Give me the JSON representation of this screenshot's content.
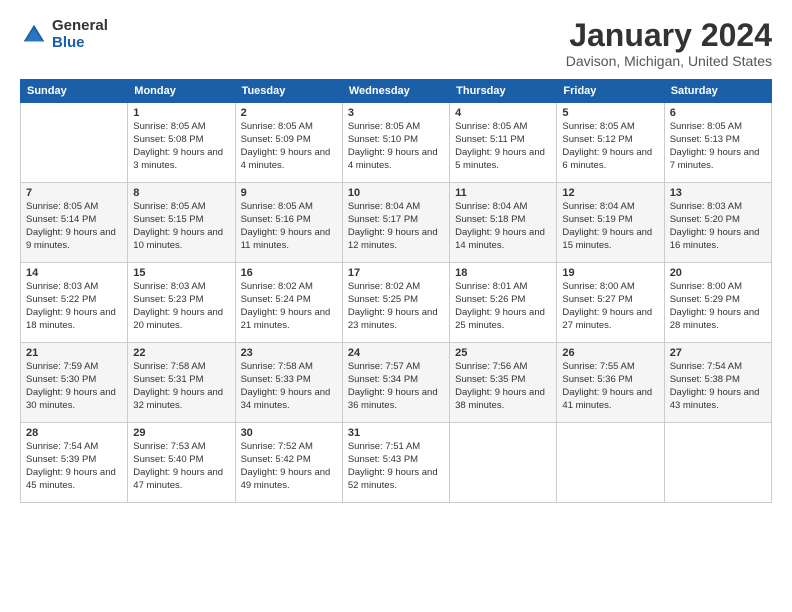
{
  "header": {
    "logo_general": "General",
    "logo_blue": "Blue",
    "title": "January 2024",
    "location": "Davison, Michigan, United States"
  },
  "calendar": {
    "days_of_week": [
      "Sunday",
      "Monday",
      "Tuesday",
      "Wednesday",
      "Thursday",
      "Friday",
      "Saturday"
    ],
    "weeks": [
      [
        {
          "day": "",
          "sunrise": "",
          "sunset": "",
          "daylight": ""
        },
        {
          "day": "1",
          "sunrise": "Sunrise: 8:05 AM",
          "sunset": "Sunset: 5:08 PM",
          "daylight": "Daylight: 9 hours and 3 minutes."
        },
        {
          "day": "2",
          "sunrise": "Sunrise: 8:05 AM",
          "sunset": "Sunset: 5:09 PM",
          "daylight": "Daylight: 9 hours and 4 minutes."
        },
        {
          "day": "3",
          "sunrise": "Sunrise: 8:05 AM",
          "sunset": "Sunset: 5:10 PM",
          "daylight": "Daylight: 9 hours and 4 minutes."
        },
        {
          "day": "4",
          "sunrise": "Sunrise: 8:05 AM",
          "sunset": "Sunset: 5:11 PM",
          "daylight": "Daylight: 9 hours and 5 minutes."
        },
        {
          "day": "5",
          "sunrise": "Sunrise: 8:05 AM",
          "sunset": "Sunset: 5:12 PM",
          "daylight": "Daylight: 9 hours and 6 minutes."
        },
        {
          "day": "6",
          "sunrise": "Sunrise: 8:05 AM",
          "sunset": "Sunset: 5:13 PM",
          "daylight": "Daylight: 9 hours and 7 minutes."
        }
      ],
      [
        {
          "day": "7",
          "sunrise": "Sunrise: 8:05 AM",
          "sunset": "Sunset: 5:14 PM",
          "daylight": "Daylight: 9 hours and 9 minutes."
        },
        {
          "day": "8",
          "sunrise": "Sunrise: 8:05 AM",
          "sunset": "Sunset: 5:15 PM",
          "daylight": "Daylight: 9 hours and 10 minutes."
        },
        {
          "day": "9",
          "sunrise": "Sunrise: 8:05 AM",
          "sunset": "Sunset: 5:16 PM",
          "daylight": "Daylight: 9 hours and 11 minutes."
        },
        {
          "day": "10",
          "sunrise": "Sunrise: 8:04 AM",
          "sunset": "Sunset: 5:17 PM",
          "daylight": "Daylight: 9 hours and 12 minutes."
        },
        {
          "day": "11",
          "sunrise": "Sunrise: 8:04 AM",
          "sunset": "Sunset: 5:18 PM",
          "daylight": "Daylight: 9 hours and 14 minutes."
        },
        {
          "day": "12",
          "sunrise": "Sunrise: 8:04 AM",
          "sunset": "Sunset: 5:19 PM",
          "daylight": "Daylight: 9 hours and 15 minutes."
        },
        {
          "day": "13",
          "sunrise": "Sunrise: 8:03 AM",
          "sunset": "Sunset: 5:20 PM",
          "daylight": "Daylight: 9 hours and 16 minutes."
        }
      ],
      [
        {
          "day": "14",
          "sunrise": "Sunrise: 8:03 AM",
          "sunset": "Sunset: 5:22 PM",
          "daylight": "Daylight: 9 hours and 18 minutes."
        },
        {
          "day": "15",
          "sunrise": "Sunrise: 8:03 AM",
          "sunset": "Sunset: 5:23 PM",
          "daylight": "Daylight: 9 hours and 20 minutes."
        },
        {
          "day": "16",
          "sunrise": "Sunrise: 8:02 AM",
          "sunset": "Sunset: 5:24 PM",
          "daylight": "Daylight: 9 hours and 21 minutes."
        },
        {
          "day": "17",
          "sunrise": "Sunrise: 8:02 AM",
          "sunset": "Sunset: 5:25 PM",
          "daylight": "Daylight: 9 hours and 23 minutes."
        },
        {
          "day": "18",
          "sunrise": "Sunrise: 8:01 AM",
          "sunset": "Sunset: 5:26 PM",
          "daylight": "Daylight: 9 hours and 25 minutes."
        },
        {
          "day": "19",
          "sunrise": "Sunrise: 8:00 AM",
          "sunset": "Sunset: 5:27 PM",
          "daylight": "Daylight: 9 hours and 27 minutes."
        },
        {
          "day": "20",
          "sunrise": "Sunrise: 8:00 AM",
          "sunset": "Sunset: 5:29 PM",
          "daylight": "Daylight: 9 hours and 28 minutes."
        }
      ],
      [
        {
          "day": "21",
          "sunrise": "Sunrise: 7:59 AM",
          "sunset": "Sunset: 5:30 PM",
          "daylight": "Daylight: 9 hours and 30 minutes."
        },
        {
          "day": "22",
          "sunrise": "Sunrise: 7:58 AM",
          "sunset": "Sunset: 5:31 PM",
          "daylight": "Daylight: 9 hours and 32 minutes."
        },
        {
          "day": "23",
          "sunrise": "Sunrise: 7:58 AM",
          "sunset": "Sunset: 5:33 PM",
          "daylight": "Daylight: 9 hours and 34 minutes."
        },
        {
          "day": "24",
          "sunrise": "Sunrise: 7:57 AM",
          "sunset": "Sunset: 5:34 PM",
          "daylight": "Daylight: 9 hours and 36 minutes."
        },
        {
          "day": "25",
          "sunrise": "Sunrise: 7:56 AM",
          "sunset": "Sunset: 5:35 PM",
          "daylight": "Daylight: 9 hours and 38 minutes."
        },
        {
          "day": "26",
          "sunrise": "Sunrise: 7:55 AM",
          "sunset": "Sunset: 5:36 PM",
          "daylight": "Daylight: 9 hours and 41 minutes."
        },
        {
          "day": "27",
          "sunrise": "Sunrise: 7:54 AM",
          "sunset": "Sunset: 5:38 PM",
          "daylight": "Daylight: 9 hours and 43 minutes."
        }
      ],
      [
        {
          "day": "28",
          "sunrise": "Sunrise: 7:54 AM",
          "sunset": "Sunset: 5:39 PM",
          "daylight": "Daylight: 9 hours and 45 minutes."
        },
        {
          "day": "29",
          "sunrise": "Sunrise: 7:53 AM",
          "sunset": "Sunset: 5:40 PM",
          "daylight": "Daylight: 9 hours and 47 minutes."
        },
        {
          "day": "30",
          "sunrise": "Sunrise: 7:52 AM",
          "sunset": "Sunset: 5:42 PM",
          "daylight": "Daylight: 9 hours and 49 minutes."
        },
        {
          "day": "31",
          "sunrise": "Sunrise: 7:51 AM",
          "sunset": "Sunset: 5:43 PM",
          "daylight": "Daylight: 9 hours and 52 minutes."
        },
        {
          "day": "",
          "sunrise": "",
          "sunset": "",
          "daylight": ""
        },
        {
          "day": "",
          "sunrise": "",
          "sunset": "",
          "daylight": ""
        },
        {
          "day": "",
          "sunrise": "",
          "sunset": "",
          "daylight": ""
        }
      ]
    ]
  }
}
